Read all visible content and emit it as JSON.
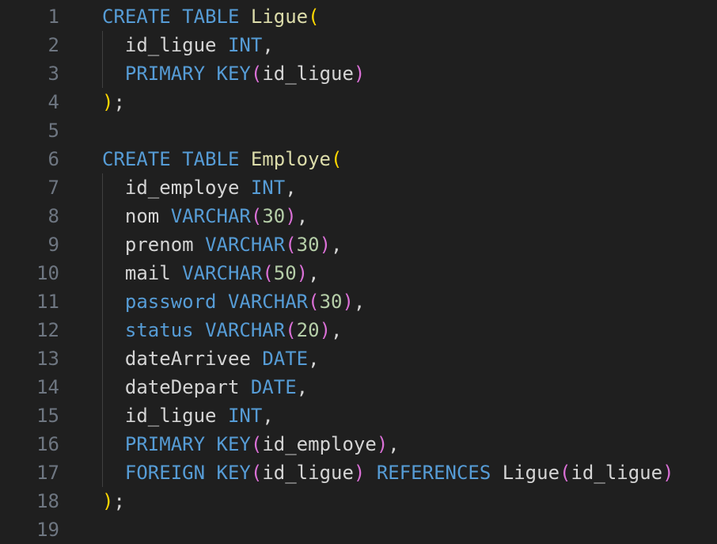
{
  "editor": {
    "language": "SQL",
    "colors": {
      "background": "#1f1f1f",
      "line_number": "#6e7681",
      "keyword": "#569cd6",
      "identifier": "#d4d4d4",
      "table_name": "#dcdcaa",
      "number": "#b5cea8",
      "bracket_level_1": "#ffd700",
      "bracket_level_2": "#da70d6"
    },
    "lines": [
      {
        "number": "1",
        "indent": "",
        "tokens": [
          {
            "t": "CREATE",
            "c": "kw"
          },
          {
            "t": " ",
            "c": "id"
          },
          {
            "t": "TABLE",
            "c": "kw"
          },
          {
            "t": " ",
            "c": "id"
          },
          {
            "t": "Ligue",
            "c": "fn"
          },
          {
            "t": "(",
            "c": "p1"
          }
        ]
      },
      {
        "number": "2",
        "indent": "  ",
        "tokens": [
          {
            "t": "id_ligue",
            "c": "id"
          },
          {
            "t": " ",
            "c": "id"
          },
          {
            "t": "INT",
            "c": "kw"
          },
          {
            "t": ",",
            "c": "punct"
          }
        ]
      },
      {
        "number": "3",
        "indent": "  ",
        "tokens": [
          {
            "t": "PRIMARY",
            "c": "kw"
          },
          {
            "t": " ",
            "c": "id"
          },
          {
            "t": "KEY",
            "c": "kw"
          },
          {
            "t": "(",
            "c": "p2"
          },
          {
            "t": "id_ligue",
            "c": "id"
          },
          {
            "t": ")",
            "c": "p2"
          }
        ]
      },
      {
        "number": "4",
        "indent": "",
        "tokens": [
          {
            "t": ")",
            "c": "p1"
          },
          {
            "t": ";",
            "c": "punct"
          }
        ]
      },
      {
        "number": "5",
        "indent": "",
        "tokens": []
      },
      {
        "number": "6",
        "indent": "",
        "tokens": [
          {
            "t": "CREATE",
            "c": "kw"
          },
          {
            "t": " ",
            "c": "id"
          },
          {
            "t": "TABLE",
            "c": "kw"
          },
          {
            "t": " ",
            "c": "id"
          },
          {
            "t": "Employe",
            "c": "fn"
          },
          {
            "t": "(",
            "c": "p1"
          }
        ]
      },
      {
        "number": "7",
        "indent": "  ",
        "tokens": [
          {
            "t": "id_employe",
            "c": "id"
          },
          {
            "t": " ",
            "c": "id"
          },
          {
            "t": "INT",
            "c": "kw"
          },
          {
            "t": ",",
            "c": "punct"
          }
        ]
      },
      {
        "number": "8",
        "indent": "  ",
        "tokens": [
          {
            "t": "nom",
            "c": "id"
          },
          {
            "t": " ",
            "c": "id"
          },
          {
            "t": "VARCHAR",
            "c": "kw"
          },
          {
            "t": "(",
            "c": "p2"
          },
          {
            "t": "30",
            "c": "num"
          },
          {
            "t": ")",
            "c": "p2"
          },
          {
            "t": ",",
            "c": "punct"
          }
        ]
      },
      {
        "number": "9",
        "indent": "  ",
        "tokens": [
          {
            "t": "prenom",
            "c": "id"
          },
          {
            "t": " ",
            "c": "id"
          },
          {
            "t": "VARCHAR",
            "c": "kw"
          },
          {
            "t": "(",
            "c": "p2"
          },
          {
            "t": "30",
            "c": "num"
          },
          {
            "t": ")",
            "c": "p2"
          },
          {
            "t": ",",
            "c": "punct"
          }
        ]
      },
      {
        "number": "10",
        "indent": "  ",
        "tokens": [
          {
            "t": "mail",
            "c": "id"
          },
          {
            "t": " ",
            "c": "id"
          },
          {
            "t": "VARCHAR",
            "c": "kw"
          },
          {
            "t": "(",
            "c": "p2"
          },
          {
            "t": "50",
            "c": "num"
          },
          {
            "t": ")",
            "c": "p2"
          },
          {
            "t": ",",
            "c": "punct"
          }
        ]
      },
      {
        "number": "11",
        "indent": "  ",
        "tokens": [
          {
            "t": "password",
            "c": "kw"
          },
          {
            "t": " ",
            "c": "id"
          },
          {
            "t": "VARCHAR",
            "c": "kw"
          },
          {
            "t": "(",
            "c": "p2"
          },
          {
            "t": "30",
            "c": "num"
          },
          {
            "t": ")",
            "c": "p2"
          },
          {
            "t": ",",
            "c": "punct"
          }
        ]
      },
      {
        "number": "12",
        "indent": "  ",
        "tokens": [
          {
            "t": "status",
            "c": "kw"
          },
          {
            "t": " ",
            "c": "id"
          },
          {
            "t": "VARCHAR",
            "c": "kw"
          },
          {
            "t": "(",
            "c": "p2"
          },
          {
            "t": "20",
            "c": "num"
          },
          {
            "t": ")",
            "c": "p2"
          },
          {
            "t": ",",
            "c": "punct"
          }
        ]
      },
      {
        "number": "13",
        "indent": "  ",
        "tokens": [
          {
            "t": "dateArrivee",
            "c": "id"
          },
          {
            "t": " ",
            "c": "id"
          },
          {
            "t": "DATE",
            "c": "kw"
          },
          {
            "t": ",",
            "c": "punct"
          }
        ]
      },
      {
        "number": "14",
        "indent": "  ",
        "tokens": [
          {
            "t": "dateDepart",
            "c": "id"
          },
          {
            "t": " ",
            "c": "id"
          },
          {
            "t": "DATE",
            "c": "kw"
          },
          {
            "t": ",",
            "c": "punct"
          }
        ]
      },
      {
        "number": "15",
        "indent": "  ",
        "tokens": [
          {
            "t": "id_ligue",
            "c": "id"
          },
          {
            "t": " ",
            "c": "id"
          },
          {
            "t": "INT",
            "c": "kw"
          },
          {
            "t": ",",
            "c": "punct"
          }
        ]
      },
      {
        "number": "16",
        "indent": "  ",
        "tokens": [
          {
            "t": "PRIMARY",
            "c": "kw"
          },
          {
            "t": " ",
            "c": "id"
          },
          {
            "t": "KEY",
            "c": "kw"
          },
          {
            "t": "(",
            "c": "p2"
          },
          {
            "t": "id_employe",
            "c": "id"
          },
          {
            "t": ")",
            "c": "p2"
          },
          {
            "t": ",",
            "c": "punct"
          }
        ]
      },
      {
        "number": "17",
        "indent": "  ",
        "tokens": [
          {
            "t": "FOREIGN",
            "c": "kw"
          },
          {
            "t": " ",
            "c": "id"
          },
          {
            "t": "KEY",
            "c": "kw"
          },
          {
            "t": "(",
            "c": "p2"
          },
          {
            "t": "id_ligue",
            "c": "id"
          },
          {
            "t": ")",
            "c": "p2"
          },
          {
            "t": " ",
            "c": "id"
          },
          {
            "t": "REFERENCES",
            "c": "kw"
          },
          {
            "t": " ",
            "c": "id"
          },
          {
            "t": "Ligue",
            "c": "id"
          },
          {
            "t": "(",
            "c": "p2"
          },
          {
            "t": "id_ligue",
            "c": "id"
          },
          {
            "t": ")",
            "c": "p2"
          }
        ]
      },
      {
        "number": "18",
        "indent": "",
        "tokens": [
          {
            "t": ")",
            "c": "p1"
          },
          {
            "t": ";",
            "c": "punct"
          }
        ]
      },
      {
        "number": "19",
        "indent": "",
        "tokens": []
      }
    ]
  }
}
